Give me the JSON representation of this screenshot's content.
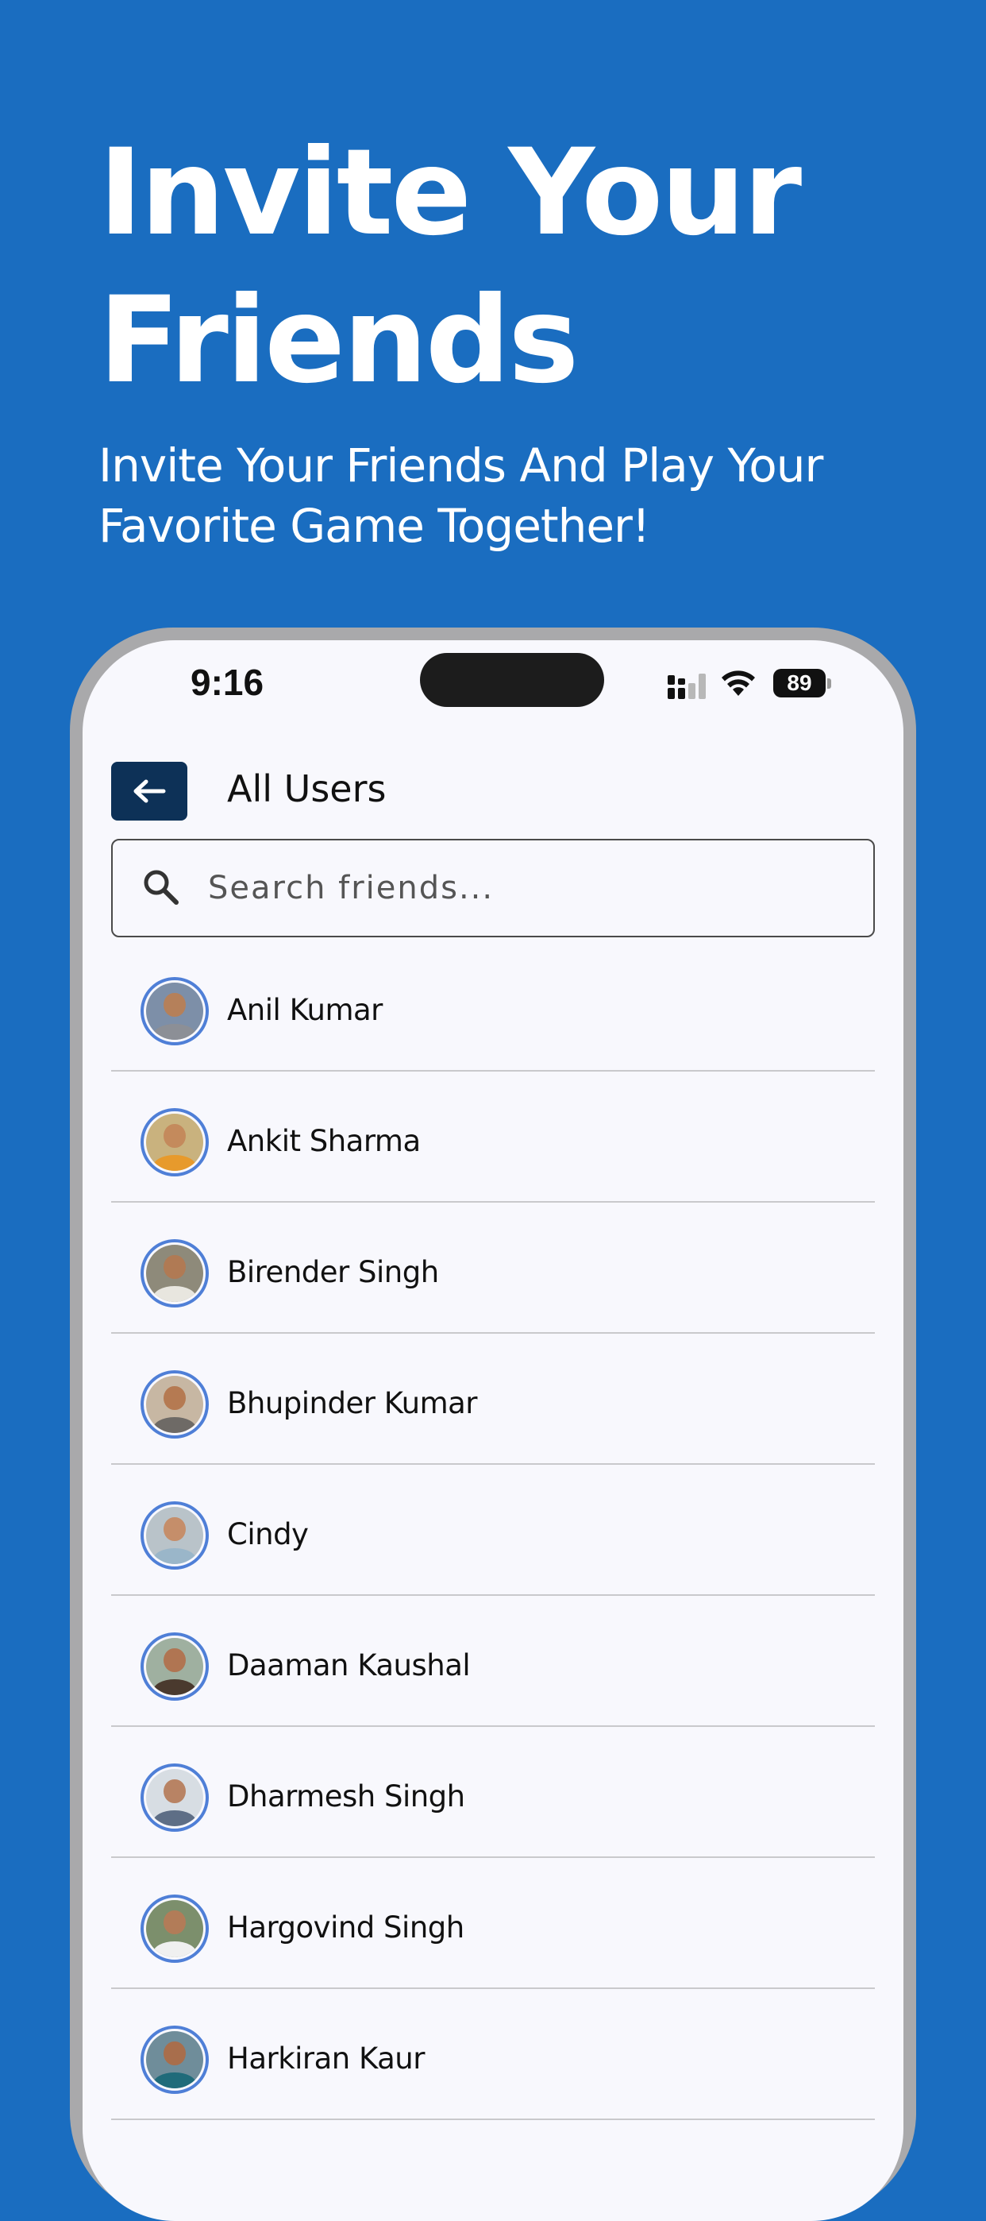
{
  "promo": {
    "headline_line1": "Invite Your",
    "headline_line2": "Friends",
    "subline_line1": "Invite Your Friends And Play Your",
    "subline_line2": "Favorite Game Together!",
    "background_color": "#1a6dc0"
  },
  "status_bar": {
    "time": "9:16",
    "battery": "89",
    "icons": [
      "signal-icon",
      "wifi-icon",
      "battery-icon"
    ]
  },
  "header": {
    "back_icon": "arrow-left-icon",
    "title": "All Users",
    "back_button_color": "#0d3157"
  },
  "search": {
    "placeholder": "Search friends...",
    "value": "",
    "icon": "search-icon"
  },
  "avatar_ring_color": "#4f7fd7",
  "users": [
    {
      "name": "Anil Kumar",
      "bg": "#7d8fa8",
      "skin": "#b5805a",
      "shirt": "#8c8f96"
    },
    {
      "name": "Ankit Sharma",
      "bg": "#c9b27e",
      "skin": "#c48a5c",
      "shirt": "#e79a2c"
    },
    {
      "name": "Birender Singh",
      "bg": "#8e8a7a",
      "skin": "#b07a54",
      "shirt": "#e8e6df"
    },
    {
      "name": "Bhupinder Kumar",
      "bg": "#c7b7a3",
      "skin": "#b57a52",
      "shirt": "#6e6a66"
    },
    {
      "name": "Cindy",
      "bg": "#b9c3c9",
      "skin": "#c58e6a",
      "shirt": "#9ab6c9"
    },
    {
      "name": "Daaman Kaushal",
      "bg": "#9fb0a0",
      "skin": "#b07552",
      "shirt": "#4a3a2e"
    },
    {
      "name": "Dharmesh Singh",
      "bg": "#d7dde3",
      "skin": "#b88364",
      "shirt": "#5e6e86"
    },
    {
      "name": "Hargovind Singh",
      "bg": "#7c8f6c",
      "skin": "#b27c58",
      "shirt": "#f0f0f0"
    },
    {
      "name": "Harkiran Kaur",
      "bg": "#6f8d9a",
      "skin": "#a86e4c",
      "shirt": "#1f6b7a"
    }
  ]
}
